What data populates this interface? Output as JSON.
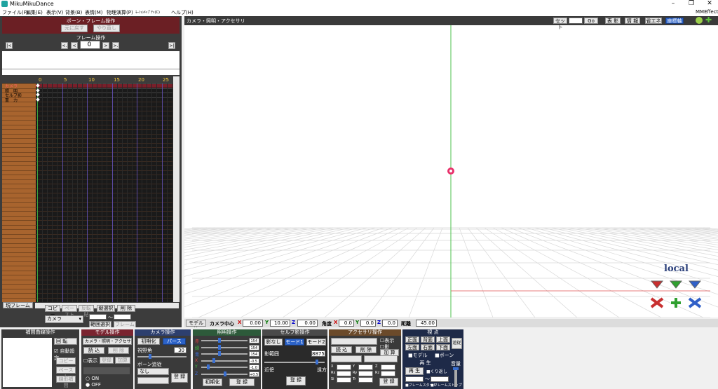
{
  "window": {
    "title": "MikuMikuDance",
    "controls": [
      "–",
      "❐",
      "✕"
    ]
  },
  "menu": {
    "items": [
      "ファイル(F)",
      "編集(E)",
      "表示(V)",
      "背景(B)",
      "表情(M)",
      "物理演算(P)",
      "ﾓｰｼｮﾝｷｬﾌﾟﾁｬ(C)",
      "ヘルプ(H)"
    ],
    "right": "MMEffect"
  },
  "left": {
    "header": "ボーン・フレーム操作",
    "btn_undo": "元に戻す",
    "btn_redo": "やり直し",
    "frame_ops": "フレーム操作",
    "frame_value": "0",
    "nav": [
      "|<",
      "<.",
      "<",
      ">",
      ">.",
      ">|"
    ],
    "ruler": [
      "0",
      "5",
      "10",
      "15",
      "20",
      "25"
    ],
    "tracks": [
      "カメラ",
      "照　明",
      "セルフ影",
      "重　力"
    ],
    "current_frame": "現フレーム",
    "btn_copy": "コピー",
    "btn_paste": "ペースト",
    "btn_reverse": "反転貼",
    "btn_vsel": "縦選択",
    "btn_delete": "削 除",
    "select_value": "カメラ",
    "tilde": "～",
    "btn_range": "範囲選択",
    "btn_expand": "フレーム展開"
  },
  "viewport": {
    "title": "カメラ・照明・アクセサリ",
    "set_label": "セット",
    "set_value": "0",
    "go_label": "Go",
    "btn_shadow": "表 影",
    "btn_info": "情 報",
    "btn_eco": "省エネ",
    "btn_axis": "座標軸",
    "local_label": "local",
    "bottom": {
      "model_edit": "モデル編",
      "cam_center": "カメラ中心",
      "x_label": "X",
      "x_value": "0.00",
      "y_label": "Y",
      "y_value": "10.00",
      "z_label": "Z",
      "z_value": "0.00",
      "angle_label": "角度",
      "ax_value": "0.0",
      "ay_value": "0.0",
      "az_value": "0.0",
      "dist_label": "距離",
      "dist_value": "45.00"
    }
  },
  "panels": {
    "interp": {
      "header": "補間曲線操作",
      "sel": "回 転",
      "auto": "自動設定",
      "btn_copy": "コピー",
      "btn_paste": "ペースト",
      "btn_linear": "線形補間"
    },
    "model": {
      "header": "モデル操作",
      "sel": "カメラ・照明・アクセサリ",
      "btn_load": "読 込",
      "btn_del": "削 除",
      "chk_show": "表示",
      "btn_reg": "登録",
      "btn_add": "加算",
      "on": "ON",
      "off": "OFF"
    },
    "camera": {
      "header": "カメラ操作",
      "btn_init": "初期化",
      "btn_perspective": "パース",
      "fov_label": "視野角",
      "fov_value": "30",
      "follow_label": "ボーン追従",
      "follow_value": "なし",
      "btn_register": "登 録"
    },
    "light": {
      "header": "照明操作",
      "labels": [
        "赤",
        "緑",
        "青",
        "X",
        "Y",
        "Z"
      ],
      "values": [
        "154",
        "154",
        "154",
        "-0.5",
        "-1.0",
        "+0.5"
      ],
      "btn_init": "初期化",
      "btn_register": "登 録"
    },
    "shadow": {
      "header": "セルフ影操作",
      "btn_none": "影なし",
      "btn_mode1": "モード1",
      "btn_mode2": "モード2",
      "range_label": "影範囲",
      "range_value": "8875",
      "near": "近傍",
      "far": "遠方",
      "btn_register": "登 録"
    },
    "accessory": {
      "header": "アクセサリ操作",
      "btn_load": "読 込",
      "btn_del": "削 除",
      "chk_show": "表示",
      "chk_shadow": "影",
      "btn_add": "加 算",
      "labels": [
        "X",
        "Y",
        "Z",
        "Rx",
        "Ry",
        "Rz",
        "Si",
        "Tr"
      ],
      "btn_register": "登 録"
    },
    "view": {
      "header": "視 点",
      "btns": [
        "正面",
        "背面",
        "上面",
        "左面",
        "右面",
        "下面"
      ],
      "btn_track": "追従",
      "chk_model": "モデル",
      "chk_bone": "ボーン"
    },
    "play": {
      "header": "再 生",
      "btn_play": "再 生",
      "chk_repeat": "くり返し",
      "tilde": "～",
      "chk_start": "フレームスタート",
      "chk_stop": "フレームストップ"
    },
    "volume": {
      "header": "音量"
    }
  },
  "colors": {
    "accent": "#2b62c8",
    "panel_header": "#6b1f24",
    "track_brown": "#a8642e"
  }
}
